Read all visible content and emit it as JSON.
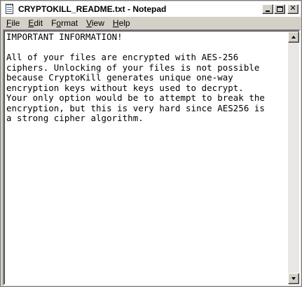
{
  "window": {
    "title": "CRYPTOKILL_README.txt - Notepad"
  },
  "menu": {
    "items": [
      {
        "accel": "F",
        "rest": "ile"
      },
      {
        "accel": "E",
        "rest": "dit"
      },
      {
        "accel": "",
        "pre": "F",
        "mid": "o",
        "rest": "rmat"
      },
      {
        "accel": "V",
        "rest": "iew"
      },
      {
        "accel": "H",
        "rest": "elp"
      }
    ]
  },
  "document": {
    "text": "IMPORTANT INFORMATION!\n\nAll of your files are encrypted with AES-256\nciphers. Unlocking of your files is not possible\nbecause CryptoKill generates unique one-way\nencryption keys without keys used to decrypt.\nYour only option would be to attempt to break the\nencryption, but this is very hard since AES256 is\na strong cipher algorithm."
  },
  "icons": {
    "app": "notepad-icon",
    "minimize": "minimize-icon",
    "maximize": "maximize-icon",
    "close": "close-icon",
    "scroll_up": "arrow-up-icon",
    "scroll_down": "arrow-down-icon"
  }
}
